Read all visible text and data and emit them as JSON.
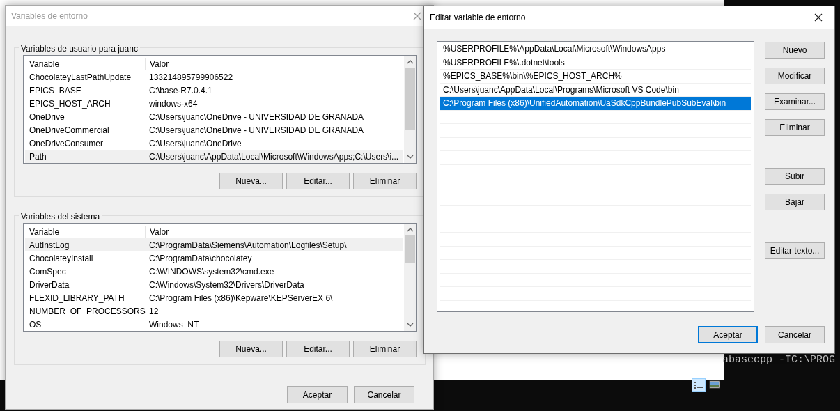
{
  "terminal": {
    "wide_line": "abasecpp -IC:\\PROG"
  },
  "env_window": {
    "title": "Variables de entorno",
    "groups": [
      {
        "title": "Variables de usuario para juanc",
        "columns": [
          "Variable",
          "Valor"
        ],
        "rows": [
          {
            "variable": "ChocolateyLastPathUpdate",
            "value": "133214895799906522",
            "selected": false
          },
          {
            "variable": "EPICS_BASE",
            "value": "C:\\base-R7.0.4.1",
            "selected": false
          },
          {
            "variable": "EPICS_HOST_ARCH",
            "value": "windows-x64",
            "selected": false
          },
          {
            "variable": "OneDrive",
            "value": "C:\\Users\\juanc\\OneDrive - UNIVERSIDAD DE GRANADA",
            "selected": false
          },
          {
            "variable": "OneDriveCommercial",
            "value": "C:\\Users\\juanc\\OneDrive - UNIVERSIDAD DE GRANADA",
            "selected": false
          },
          {
            "variable": "OneDriveConsumer",
            "value": "C:\\Users\\juanc\\OneDrive",
            "selected": false
          },
          {
            "variable": "Path",
            "value": "C:\\Users\\juanc\\AppData\\Local\\Microsoft\\WindowsApps;C:\\Users\\i...",
            "selected": true
          }
        ],
        "buttons": [
          "Nueva...",
          "Editar...",
          "Eliminar"
        ]
      },
      {
        "title": "Variables del sistema",
        "columns": [
          "Variable",
          "Valor"
        ],
        "rows": [
          {
            "variable": "AutInstLog",
            "value": "C:\\ProgramData\\Siemens\\Automation\\Logfiles\\Setup\\",
            "selected": true
          },
          {
            "variable": "ChocolateyInstall",
            "value": "C:\\ProgramData\\chocolatey",
            "selected": false
          },
          {
            "variable": "ComSpec",
            "value": "C:\\WINDOWS\\system32\\cmd.exe",
            "selected": false
          },
          {
            "variable": "DriverData",
            "value": "C:\\Windows\\System32\\Drivers\\DriverData",
            "selected": false
          },
          {
            "variable": "FLEXID_LIBRARY_PATH",
            "value": "C:\\Program Files (x86)\\Kepware\\KEPServerEX 6\\",
            "selected": false
          },
          {
            "variable": "NUMBER_OF_PROCESSORS",
            "value": "12",
            "selected": false
          },
          {
            "variable": "OS",
            "value": "Windows_NT",
            "selected": false
          }
        ],
        "buttons": [
          "Nueva...",
          "Editar...",
          "Eliminar"
        ]
      }
    ],
    "footer_buttons": [
      {
        "label": "Aceptar",
        "default": false
      },
      {
        "label": "Cancelar",
        "default": false
      }
    ]
  },
  "edit_window": {
    "title": "Editar variable de entorno",
    "entries": [
      {
        "text": "%USERPROFILE%\\AppData\\Local\\Microsoft\\WindowsApps",
        "selected": false
      },
      {
        "text": "%USERPROFILE%\\.dotnet\\tools",
        "selected": false
      },
      {
        "text": "%EPICS_BASE%\\bin\\%EPICS_HOST_ARCH%",
        "selected": false
      },
      {
        "text": "C:\\Users\\juanc\\AppData\\Local\\Programs\\Microsoft VS Code\\bin",
        "selected": false
      },
      {
        "text": "C:\\Program Files (x86)\\UnifiedAutomation\\UaSdkCppBundlePubSubEval\\bin",
        "selected": true
      }
    ],
    "side_buttons": [
      {
        "label": "Nuevo",
        "kind": "button"
      },
      {
        "label": "Modificar",
        "kind": "button"
      },
      {
        "label": "Examinar...",
        "kind": "button"
      },
      {
        "label": "Eliminar",
        "kind": "button"
      },
      {
        "kind": "gap"
      },
      {
        "label": "Subir",
        "kind": "button"
      },
      {
        "label": "Bajar",
        "kind": "button"
      },
      {
        "kind": "gap"
      },
      {
        "label": "Editar texto...",
        "kind": "button"
      }
    ],
    "footer_buttons": [
      {
        "label": "Aceptar",
        "default": true
      },
      {
        "label": "Cancelar",
        "default": false
      }
    ]
  }
}
